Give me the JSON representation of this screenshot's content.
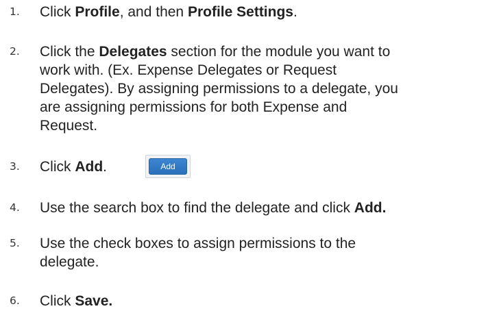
{
  "steps": [
    {
      "number": "1.",
      "parts": [
        "Click ",
        "Profile",
        ", and then ",
        "Profile Settings",
        "."
      ]
    },
    {
      "number": "2.",
      "p1": "Click the ",
      "b1": "Delegates",
      "p2": " section for the module you want to",
      "lines": [
        "work with. (Ex.  Expense Delegates or Request",
        "Delegates). By assigning permissions to a delegate, you",
        "are assigning permissions for both Expense and",
        "Request."
      ]
    },
    {
      "number": "3.",
      "parts": [
        "Click ",
        "Add",
        "."
      ],
      "button_label": "Add"
    },
    {
      "number": "4.",
      "parts": [
        "Use the search box to find the delegate and click ",
        "Add."
      ]
    },
    {
      "number": "5.",
      "lines": [
        "Use the check boxes to assign permissions to the",
        "delegate."
      ]
    },
    {
      "number": "6.",
      "parts": [
        "Click ",
        "Save."
      ]
    }
  ]
}
